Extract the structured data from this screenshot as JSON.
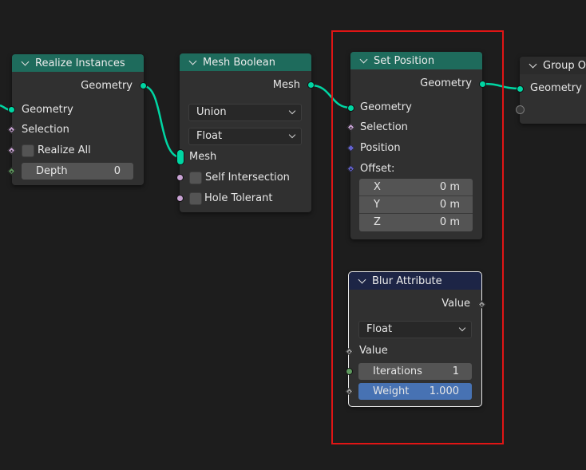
{
  "nodes": {
    "realize": {
      "title": "Realize Instances",
      "out_geometry": "Geometry",
      "in_geometry": "Geometry",
      "selection": "Selection",
      "realize_all": "Realize All",
      "depth_label": "Depth",
      "depth_value": "0"
    },
    "boolean": {
      "title": "Mesh Boolean",
      "out_mesh": "Mesh",
      "operation": "Union",
      "solver": "Float",
      "in_mesh": "Mesh",
      "self_intersection": "Self Intersection",
      "hole_tolerant": "Hole Tolerant"
    },
    "setpos": {
      "title": "Set Position",
      "out_geometry": "Geometry",
      "in_geometry": "Geometry",
      "selection": "Selection",
      "position": "Position",
      "offset": "Offset:",
      "x_label": "X",
      "x_value": "0 m",
      "y_label": "Y",
      "y_value": "0 m",
      "z_label": "Z",
      "z_value": "0 m"
    },
    "blur": {
      "title": "Blur Attribute",
      "out_value": "Value",
      "data_type": "Float",
      "in_value": "Value",
      "iterations_label": "Iterations",
      "iterations_value": "1",
      "weight_label": "Weight",
      "weight_value": "1.000"
    },
    "group_output": {
      "title": "Group O",
      "in_geometry": "Geometry"
    }
  },
  "colors": {
    "background": "#1d1d1d",
    "geometry_socket": "#00d6a3",
    "geometry_header": "#1e6b5c",
    "attribute_header": "#1d2546",
    "highlight_frame": "#e01515",
    "selected_field": "#4772b3"
  }
}
